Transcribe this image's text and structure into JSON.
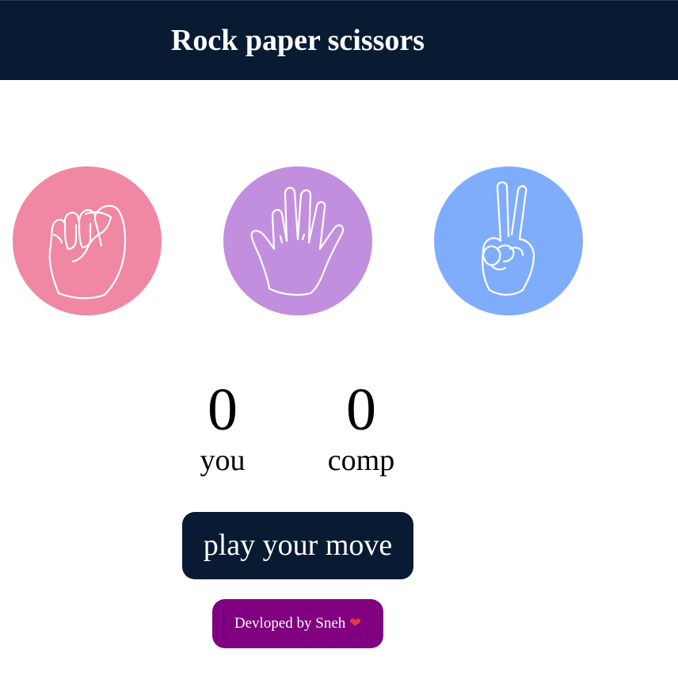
{
  "header": {
    "title": "Rock paper scissors",
    "background": "#081b33"
  },
  "choices": [
    {
      "id": "rock",
      "icon": "fist-icon",
      "color": "#f087a3"
    },
    {
      "id": "paper",
      "icon": "open-hand-icon",
      "color": "#c28fde"
    },
    {
      "id": "scissors",
      "icon": "peace-hand-icon",
      "color": "#7fadfb"
    }
  ],
  "scoreboard": {
    "user": {
      "score": "0",
      "label": "you"
    },
    "computer": {
      "score": "0",
      "label": "comp"
    }
  },
  "message": {
    "text": "play your move",
    "background": "#081b33"
  },
  "footer": {
    "text": "Devloped by Sneh",
    "heart": "❤",
    "background": "#800080"
  }
}
